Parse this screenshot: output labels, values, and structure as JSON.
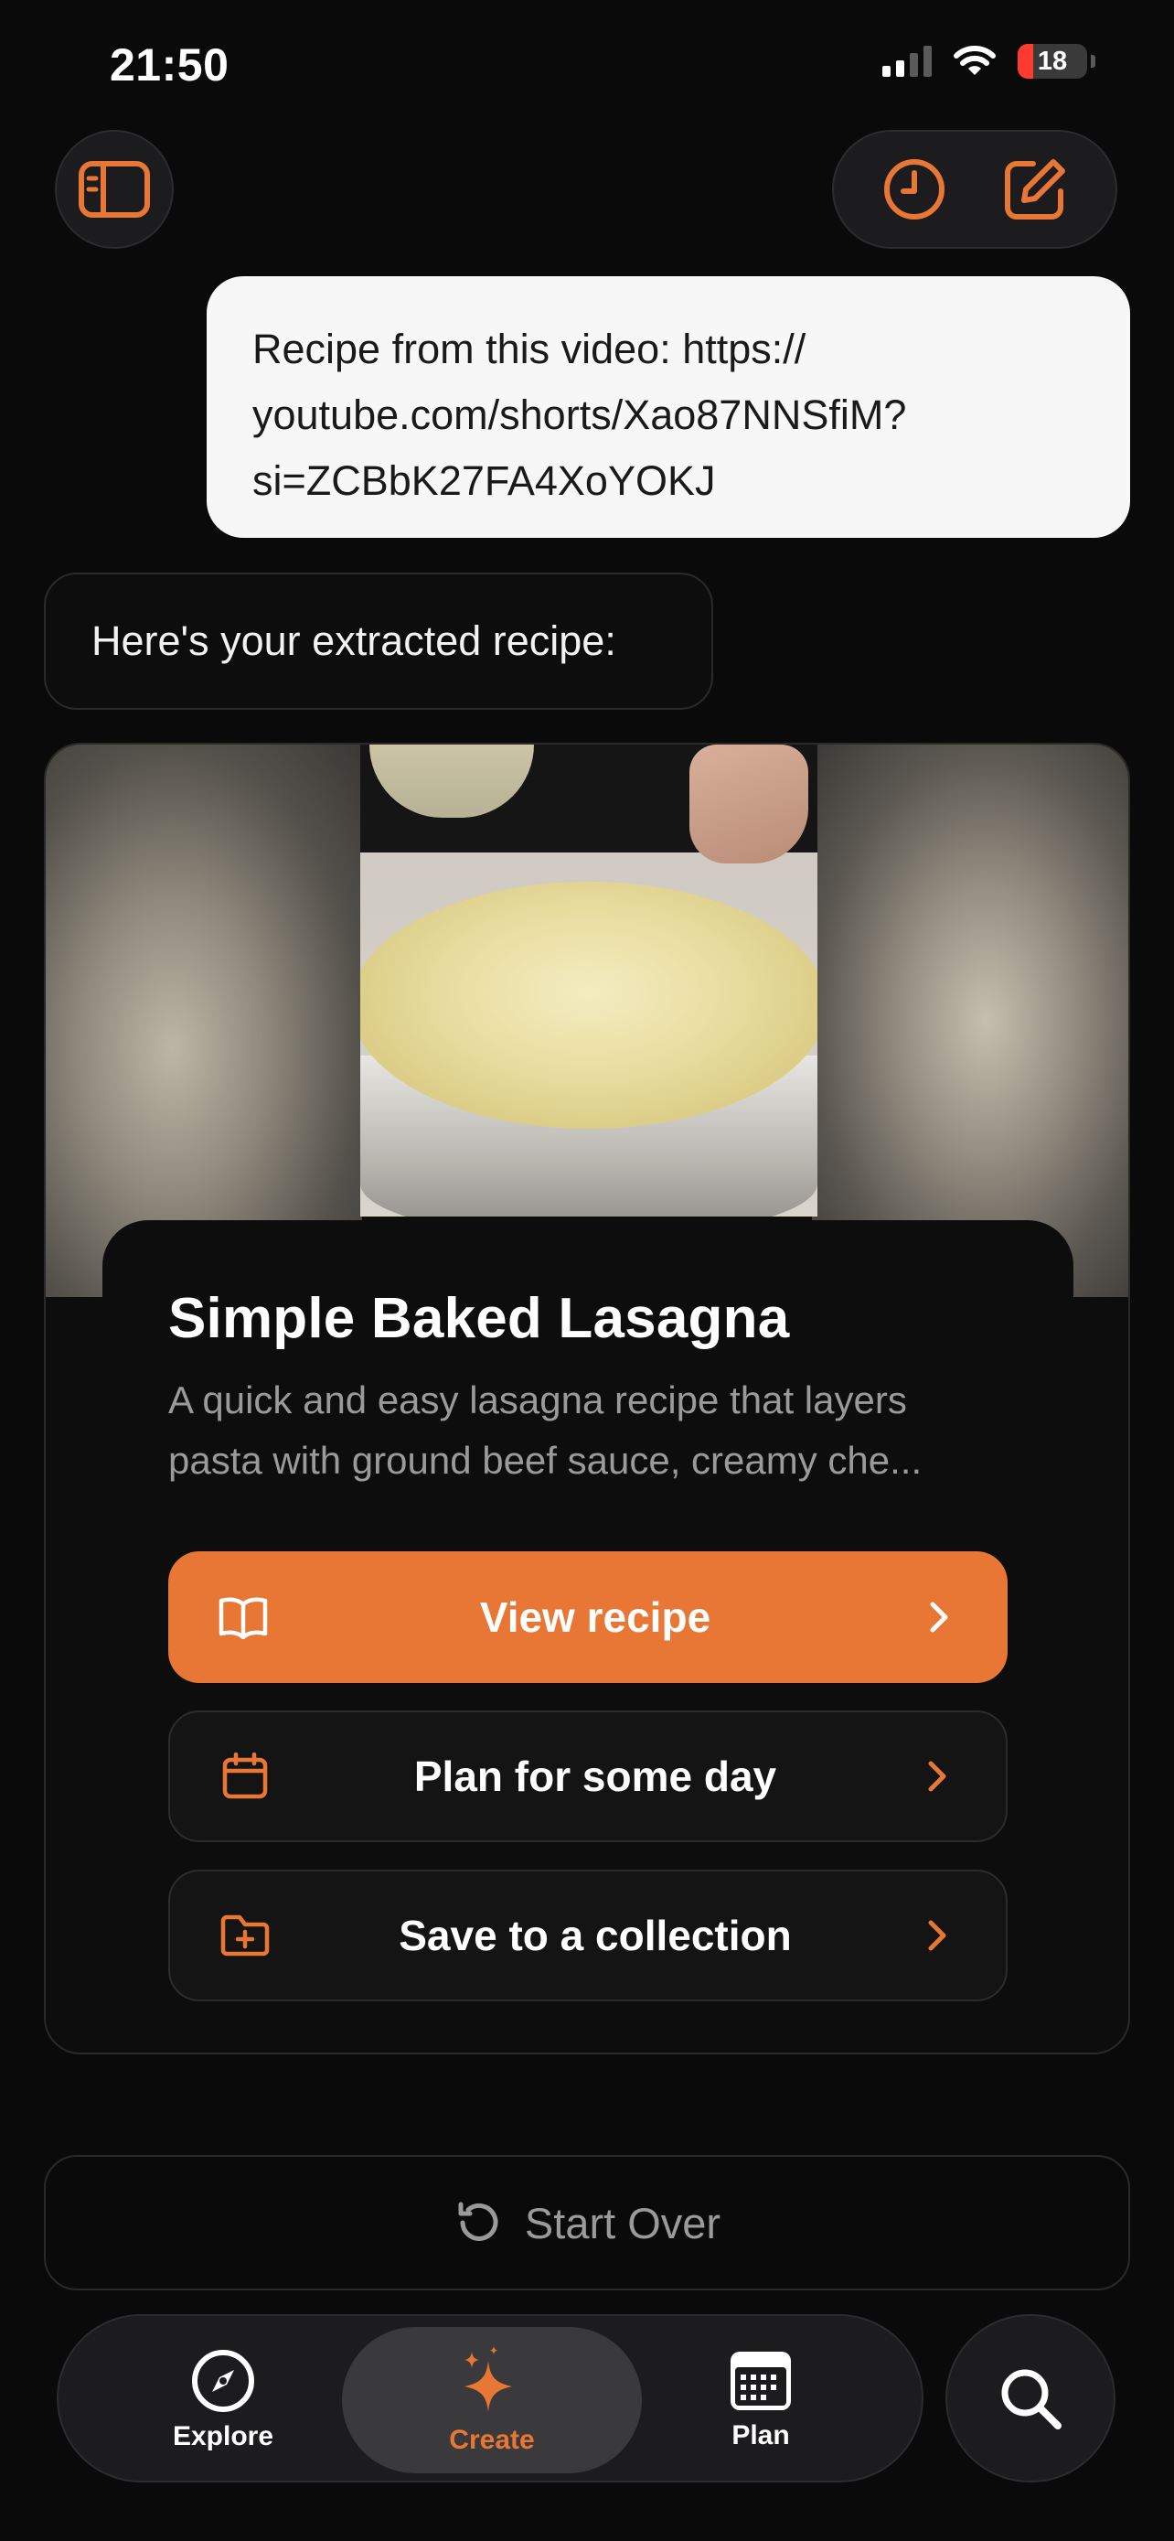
{
  "status_bar": {
    "time": "21:50",
    "battery": "18"
  },
  "chat": {
    "user_message_lines": [
      "Recipe from this video: https://",
      "youtube.com/shorts/Xao87NNSfiM?",
      "si=ZCBbK27FA4XoYOKJ"
    ],
    "assistant_message": "Here's your extracted recipe:"
  },
  "recipe": {
    "title": "Simple Baked Lasagna",
    "description_lines": [
      "A quick and easy lasagna recipe that layers",
      "pasta with ground beef sauce, creamy che..."
    ],
    "actions": [
      {
        "label": "View recipe",
        "icon": "book-open-icon"
      },
      {
        "label": "Plan for some day",
        "icon": "calendar-icon"
      },
      {
        "label": "Save to a collection",
        "icon": "folder-plus-icon"
      }
    ]
  },
  "start_over_label": "Start Over",
  "bottom_nav": {
    "items": [
      {
        "label": "Explore",
        "icon": "compass-icon"
      },
      {
        "label": "Create",
        "icon": "sparkles-icon",
        "active": true
      },
      {
        "label": "Plan",
        "icon": "calendar-grid-icon"
      }
    ],
    "search_icon": "search-icon"
  },
  "colors": {
    "accent": "#e87634",
    "background": "#0a0a0a",
    "surface": "#1c1c1e",
    "muted_text": "#9a9a9a"
  }
}
